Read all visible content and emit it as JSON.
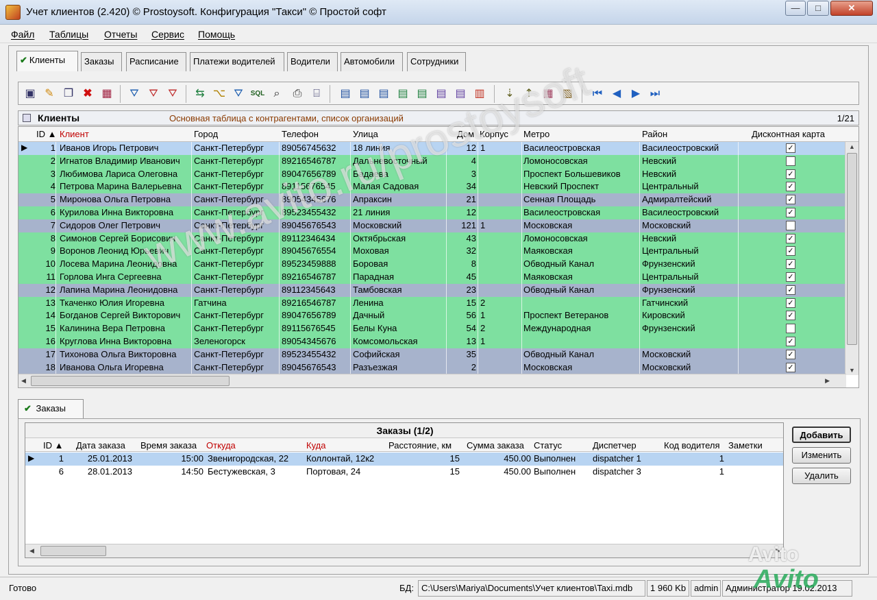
{
  "window": {
    "title": "Учет клиентов (2.420) © Prostoysoft. Конфигурация \"Такси\" © Простой софт",
    "min_glyph": "—",
    "max_glyph": "□",
    "close_glyph": "✕"
  },
  "menu": [
    "Файл",
    "Таблицы",
    "Отчеты",
    "Сервис",
    "Помощь"
  ],
  "tabs": [
    "Клиенты",
    "Заказы",
    "Расписание",
    "Платежи водителей",
    "Водители",
    "Автомобили",
    "Сотрудники"
  ],
  "toolbar_icons": [
    "export-icon",
    "edit-icon",
    "copy-icon",
    "delete-icon",
    "table-icon",
    "filter-icon",
    "filter-add-icon",
    "filter-remove-icon",
    "refresh-icon",
    "tree-icon",
    "filter-set-icon",
    "sql-icon",
    "find-icon",
    "print-icon",
    "preview-icon",
    "word-icon",
    "excel-icon",
    "html-icon",
    "xml-icon",
    "csv-icon",
    "txt-icon",
    "pdf-icon",
    "chart-icon",
    "sort-asc-icon",
    "sort-desc-icon",
    "columns-icon",
    "settings-icon",
    "first-icon",
    "prev-icon",
    "next-icon",
    "last-icon"
  ],
  "clients": {
    "title": "Клиенты",
    "description": "Основная таблица с контрагентами, список организаций",
    "counter": "1/21",
    "columns": [
      "ID ▲",
      "Клиент",
      "Город",
      "Телефон",
      "Улица",
      "Дом",
      "Корпус",
      "Метро",
      "Район",
      "Дисконтная карта"
    ],
    "rows": [
      {
        "id": "1",
        "name": "Иванов Игорь Петрович",
        "city": "Санкт-Петербург",
        "phone": "89056745632",
        "street": "18 линия",
        "house": "12",
        "korpus": "1",
        "metro": "Василеостровская",
        "district": "Василеостровский",
        "card": "✓",
        "style": "sel"
      },
      {
        "id": "2",
        "name": "Игнатов Владимир Иванович",
        "city": "Санкт-Петербург",
        "phone": "89216546787",
        "street": "Дальневосточный",
        "house": "4",
        "korpus": "",
        "metro": "Ломоносовская",
        "district": "Невский",
        "card": "",
        "style": "green"
      },
      {
        "id": "3",
        "name": "Любимова Лариса Олеговна",
        "city": "Санкт-Петербург",
        "phone": "89047656789",
        "street": "Бадаева",
        "house": "3",
        "korpus": "",
        "metro": "Проспект Большевиков",
        "district": "Невский",
        "card": "✓",
        "style": "green"
      },
      {
        "id": "4",
        "name": "Петрова Марина Валерьевна",
        "city": "Санкт-Петербург",
        "phone": "89115676545",
        "street": "Малая Садовая",
        "house": "34",
        "korpus": "",
        "metro": "Невский Проспект",
        "district": "Центральный",
        "card": "✓",
        "style": "green"
      },
      {
        "id": "5",
        "name": "Миронова Ольга Петровна",
        "city": "Санкт-Петербург",
        "phone": "89054345676",
        "street": "Апраксин",
        "house": "21",
        "korpus": "",
        "metro": "Сенная Площадь",
        "district": "Адмиралтейский",
        "card": "✓",
        "style": "blue"
      },
      {
        "id": "6",
        "name": "Курилова Инна Викторовна",
        "city": "Санкт-Петербург",
        "phone": "89523455432",
        "street": "21 линия",
        "house": "12",
        "korpus": "",
        "metro": "Василеостровская",
        "district": "Василеостровский",
        "card": "✓",
        "style": "green"
      },
      {
        "id": "7",
        "name": "Сидоров Олег Петрович",
        "city": "Санкт-Петербург",
        "phone": "89045676543",
        "street": "Московский",
        "house": "121",
        "korpus": "1",
        "metro": "Московская",
        "district": "Московский",
        "card": "",
        "style": "blue"
      },
      {
        "id": "8",
        "name": "Симонов Сергей Борисович",
        "city": "Санкт-Петербург",
        "phone": "89112346434",
        "street": "Октябрьская",
        "house": "43",
        "korpus": "",
        "metro": "Ломоносовская",
        "district": "Невский",
        "card": "✓",
        "style": "green"
      },
      {
        "id": "9",
        "name": "Воронов Леонид Юрьевич",
        "city": "Санкт-Петербург",
        "phone": "89045676554",
        "street": "Моховая",
        "house": "32",
        "korpus": "",
        "metro": "Маяковская",
        "district": "Центральный",
        "card": "✓",
        "style": "green"
      },
      {
        "id": "10",
        "name": "Лосева Марина Леонидовна",
        "city": "Санкт-Петербург",
        "phone": "89523459888",
        "street": "Боровая",
        "house": "8",
        "korpus": "",
        "metro": "Обводный Канал",
        "district": "Фрунзенский",
        "card": "✓",
        "style": "green"
      },
      {
        "id": "11",
        "name": "Горлова Инга Сергеевна",
        "city": "Санкт-Петербург",
        "phone": "89216546787",
        "street": "Парадная",
        "house": "45",
        "korpus": "",
        "metro": "Маяковская",
        "district": "Центральный",
        "card": "✓",
        "style": "green"
      },
      {
        "id": "12",
        "name": "Лапина Марина Леонидовна",
        "city": "Санкт-Петербург",
        "phone": "89112345643",
        "street": "Тамбовская",
        "house": "23",
        "korpus": "",
        "metro": "Обводный Канал",
        "district": "Фрунзенский",
        "card": "✓",
        "style": "blue"
      },
      {
        "id": "13",
        "name": "Ткаченко Юлия Игоревна",
        "city": "Гатчина",
        "phone": "89216546787",
        "street": "Ленина",
        "house": "15",
        "korpus": "2",
        "metro": "",
        "district": "Гатчинский",
        "card": "✓",
        "style": "green"
      },
      {
        "id": "14",
        "name": "Богданов Сергей Викторович",
        "city": "Санкт-Петербург",
        "phone": "89047656789",
        "street": "Дачный",
        "house": "56",
        "korpus": "1",
        "metro": "Проспект Ветеранов",
        "district": "Кировский",
        "card": "✓",
        "style": "green"
      },
      {
        "id": "15",
        "name": "Калинина Вера Петровна",
        "city": "Санкт-Петербург",
        "phone": "89115676545",
        "street": "Белы Куна",
        "house": "54",
        "korpus": "2",
        "metro": "Международная",
        "district": "Фрунзенский",
        "card": "",
        "style": "green"
      },
      {
        "id": "16",
        "name": "Круглова Инна Викторовна",
        "city": "Зеленогорск",
        "phone": "89054345676",
        "street": "Комсомольская",
        "house": "13",
        "korpus": "1",
        "metro": "",
        "district": "",
        "card": "✓",
        "style": "green"
      },
      {
        "id": "17",
        "name": "Тихонова Ольга Викторовна",
        "city": "Санкт-Петербург",
        "phone": "89523455432",
        "street": "Софийская",
        "house": "35",
        "korpus": "",
        "metro": "Обводный Канал",
        "district": "Московский",
        "card": "✓",
        "style": "blue"
      },
      {
        "id": "18",
        "name": "Иванова Ольга Игоревна",
        "city": "Санкт-Петербург",
        "phone": "89045676543",
        "street": "Разъезжая",
        "house": "2",
        "korpus": "",
        "metro": "Московская",
        "district": "Московский",
        "card": "✓",
        "style": "blue"
      }
    ]
  },
  "orders_tab": "Заказы",
  "orders": {
    "title": "Заказы (1/2)",
    "columns": [
      "ID ▲",
      "Дата заказа",
      "Время заказа",
      "Откуда",
      "Куда",
      "Расстояние, км",
      "Сумма заказа",
      "Статус",
      "Диспетчер",
      "Код водителя",
      "Заметки"
    ],
    "rows": [
      {
        "id": "1",
        "date": "25.01.2013",
        "time": "15:00",
        "from": "Звенигородская, 22",
        "to": "Коллонтай, 12к2",
        "distance": "15",
        "sum": "450.00",
        "status": "Выполнен",
        "dispatcher": "dispatcher 1",
        "driver": "1",
        "notes": ""
      },
      {
        "id": "6",
        "date": "28.01.2013",
        "time": "14:50",
        "from": "Бестужевская, 3",
        "to": "Портовая, 24",
        "distance": "15",
        "sum": "450.00",
        "status": "Выполнен",
        "dispatcher": "dispatcher 3",
        "driver": "1",
        "notes": ""
      }
    ]
  },
  "buttons": {
    "add": "Добавить",
    "edit": "Изменить",
    "delete": "Удалить"
  },
  "status": {
    "ready": "Готово",
    "db_label": "БД:",
    "db_path": "C:\\Users\\Mariya\\Documents\\Учет клиентов\\Taxi.mdb",
    "size": "1 960 Kb",
    "user": "admin",
    "role_date": "Администратор 19.02.2013"
  },
  "watermarks": {
    "site": "www.avito.ru/prostoysoft",
    "avito": "Avito",
    "avito2": "Avito"
  },
  "colors": {
    "row_green": "#7ee0a0",
    "row_blue": "#a7b3cc",
    "row_selected": "#b8d4f2",
    "header_red": "#c00000"
  }
}
